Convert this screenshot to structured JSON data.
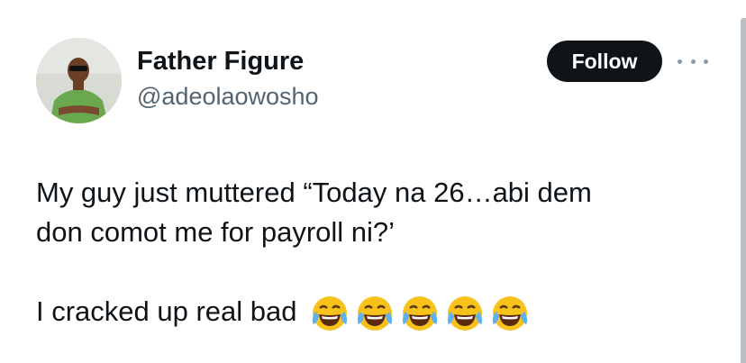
{
  "author": {
    "display_name": "Father Figure",
    "handle": "@adeolaowosho"
  },
  "follow_label": "Follow",
  "more_icon": "more-horizontal-icon",
  "tweet": {
    "line1": "My guy just muttered “Today na 26…abi dem",
    "line2": "don comot me for payroll ni?’",
    "line3": "I cracked up real bad",
    "emoji": [
      "face-with-tears-of-joy",
      "face-with-tears-of-joy",
      "face-with-tears-of-joy",
      "face-with-tears-of-joy",
      "face-with-tears-of-joy"
    ]
  },
  "colors": {
    "text": "#0f1419",
    "secondary": "#536471",
    "button_bg": "#0f1419",
    "button_text": "#ffffff"
  }
}
